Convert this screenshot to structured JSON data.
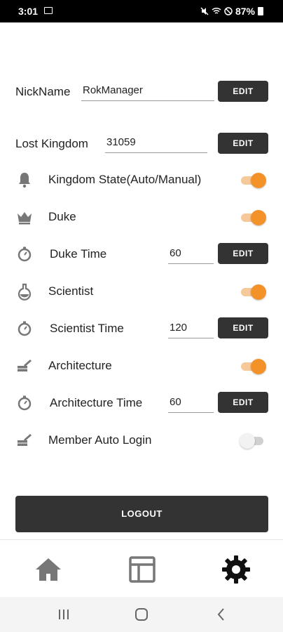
{
  "status_bar": {
    "time": "3:01",
    "battery": "87%"
  },
  "nickname": {
    "label": "NickName",
    "value": "RokManager",
    "edit_label": "EDIT"
  },
  "lost_kingdom": {
    "label": "Lost Kingdom",
    "value": "31059",
    "edit_label": "EDIT"
  },
  "settings": [
    {
      "key": "kingdom_state",
      "label": "Kingdom State(Auto/Manual)",
      "icon": "bell-icon",
      "on": true
    },
    {
      "key": "duke",
      "label": "Duke",
      "icon": "crown-icon",
      "on": true
    },
    {
      "key": "scientist",
      "label": "Scientist",
      "icon": "flask-icon",
      "on": true
    },
    {
      "key": "architecture",
      "label": "Architecture",
      "icon": "trowel-brick-icon",
      "on": true
    },
    {
      "key": "member_auto_login",
      "label": "Member Auto Login",
      "icon": "trowel-brick-icon",
      "on": false
    }
  ],
  "timers": {
    "duke_time": {
      "label": "Duke Time",
      "value": "60",
      "edit_label": "EDIT"
    },
    "scientist_time": {
      "label": "Scientist Time",
      "value": "120",
      "edit_label": "EDIT"
    },
    "architecture_time": {
      "label": "Architecture Time",
      "value": "60",
      "edit_label": "EDIT"
    }
  },
  "logout_label": "LOGOUT",
  "tab_bar": {
    "items": [
      "home-icon",
      "table-icon",
      "gear-icon"
    ],
    "active": "gear-icon"
  },
  "colors": {
    "toggle_on": "#f4922a",
    "toggle_track_on": "#f6c99a",
    "button_dark": "#333333"
  }
}
